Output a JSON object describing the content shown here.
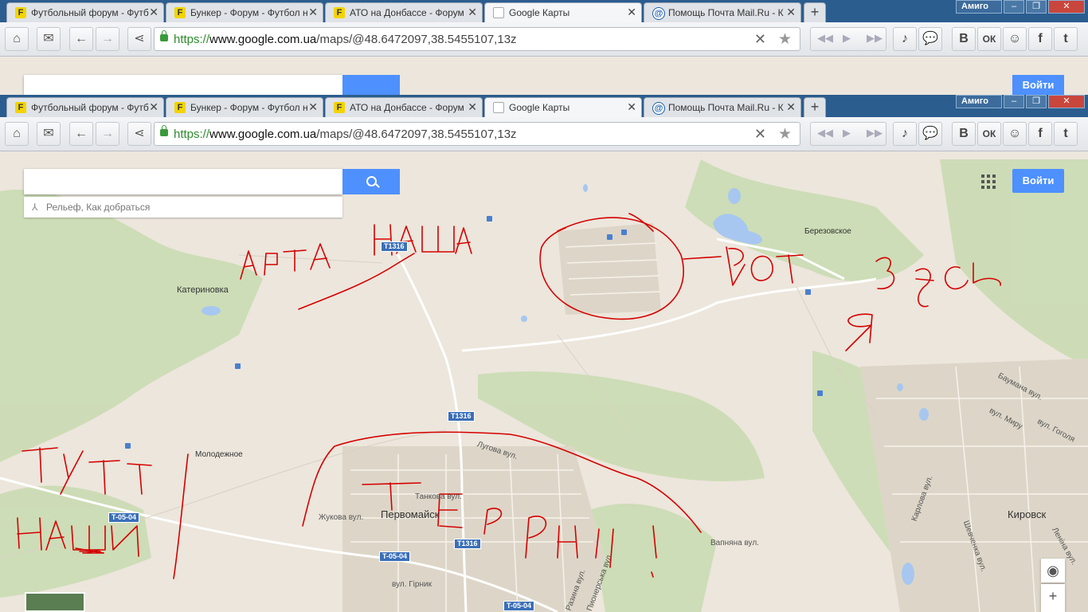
{
  "browser": {
    "tabs": [
      {
        "label": "Футбольный форум - Футб",
        "icon": "F"
      },
      {
        "label": "Бункер - Форум - Футбол н",
        "icon": "F"
      },
      {
        "label": "АТО на Донбассе - Форум",
        "icon": "F"
      },
      {
        "label": "Google Карты",
        "icon": "map"
      },
      {
        "label": "Помощь Почта Mail.Ru - К",
        "icon": "@"
      }
    ],
    "active_tab": 3,
    "new_tab_label": "+",
    "window": {
      "profile": "Амиго",
      "minimize": "–",
      "maximize": "❐",
      "close": "✕"
    },
    "address": {
      "scheme": "https://",
      "host": "www.google.com.ua",
      "path": "/maps/@48.6472097,38.5455107,13z"
    },
    "social_buttons": [
      "В",
      "ОК",
      "f",
      "t"
    ]
  },
  "maps": {
    "search_placeholder": "",
    "suggest_text": "Рельеф, Как добраться",
    "signin_label": "Войти",
    "labels": {
      "katerinovka": "Катериновка",
      "berezovskoe": "Березовское",
      "molodezhnoe": "Молодежное",
      "pervomaysk": "Первомайск",
      "kirovsk": "Кировск",
      "lugovaya": "Лугова вул.",
      "tankova": "Танкова вул.",
      "zhukova": "Жукова вул.",
      "girnik": "вул. Гірник",
      "vapnyana": "Вапняна вул.",
      "baumana": "Баумана вул.",
      "miru": "вул. Миру",
      "gogolya": "вул. Гоголя",
      "karlova": "Карлова вул.",
      "shevchenka": "Шевченка вул.",
      "lenina": "Леніна вул.",
      "razina": "Разина вул.",
      "pionerska": "Пионерська вул."
    },
    "roads": {
      "t1316_a": "T1316",
      "t1316_b": "T1316",
      "t1316_c": "T1316",
      "t0504_a": "T-05-04",
      "t0504_b": "T-05-04",
      "t0504_c": "T-05-04"
    }
  },
  "colors": {
    "map_bg": "#ece6dc",
    "green": "#c9dcb3",
    "water": "#a7c7f0",
    "road": "#ffffff",
    "annotation": "#d50000",
    "accent": "#4d90fe"
  }
}
